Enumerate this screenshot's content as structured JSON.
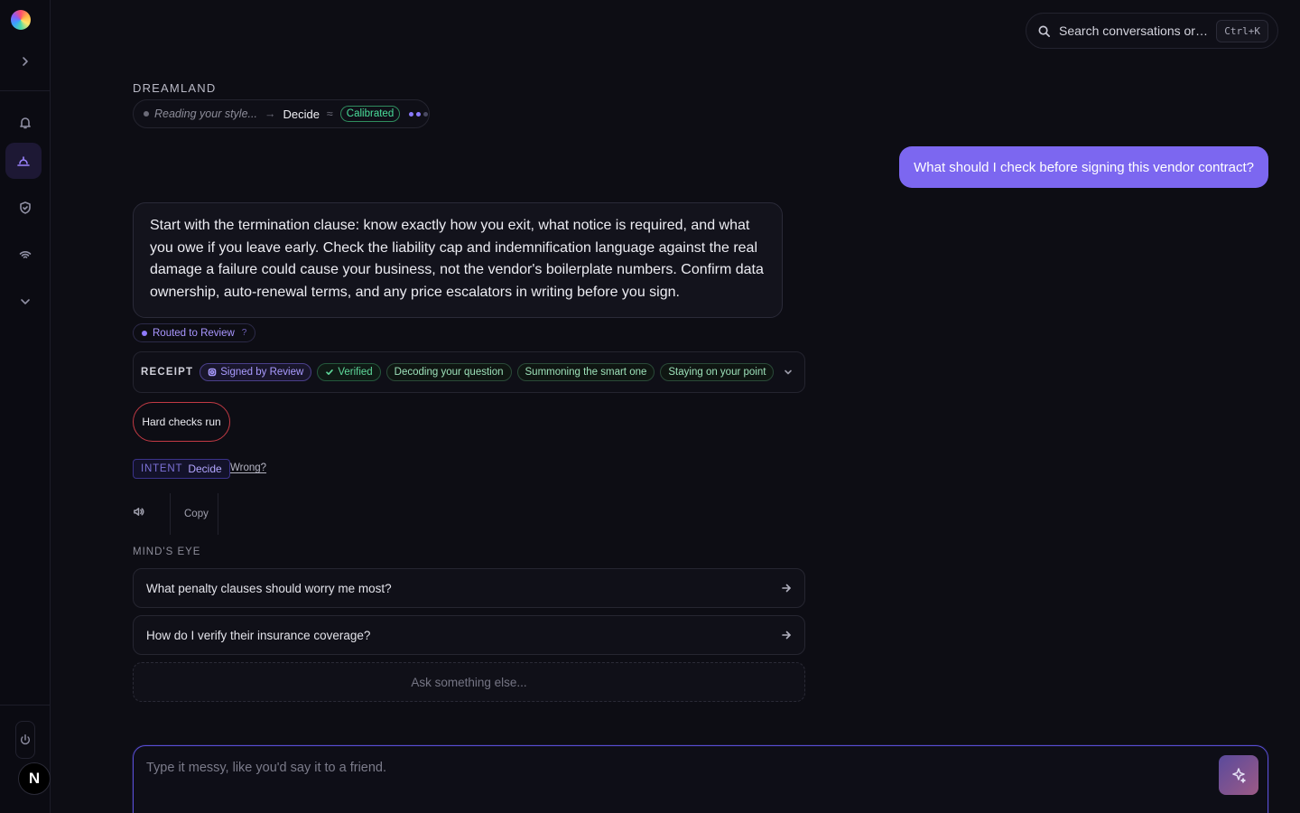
{
  "search": {
    "placeholder": "Search conversations or ju...",
    "shortcut": "Ctrl+K"
  },
  "sidebar": {
    "items": [
      {
        "name": "expand",
        "icon": "chevron-right-icon"
      },
      {
        "name": "notifications",
        "icon": "bell-icon"
      },
      {
        "name": "dreamland",
        "icon": "sunrise-icon",
        "active": true
      },
      {
        "name": "security",
        "icon": "shield-check-icon"
      },
      {
        "name": "signal",
        "icon": "wifi-icon"
      },
      {
        "name": "more",
        "icon": "chevron-down-icon"
      }
    ],
    "power_icon": "power-icon",
    "avatar_initial": "N"
  },
  "header": {
    "brand": "DREAMLAND",
    "status": {
      "reading": "Reading your style...",
      "arrow": "→",
      "mode": "Decide",
      "approx": "≈",
      "badge": "Calibrated"
    }
  },
  "conversation": {
    "user_message": "What should I check before signing this vendor contract?",
    "assistant_message": "Start with the termination clause: know exactly how you exit, what notice is required, and what you owe if you leave early. Check the liability cap and indemnification language against the real damage a failure could cause your business, not the vendor's boilerplate numbers. Confirm data ownership, auto-renewal terms, and any price escalators in writing before you sign.",
    "routed": {
      "label": "Routed to Review",
      "help": "?"
    },
    "receipt": {
      "label": "RECEIPT",
      "chips": [
        {
          "label": "Signed by Review",
          "style": "purple",
          "icon": "seal-icon"
        },
        {
          "label": "Verified",
          "style": "green",
          "icon": "check-icon"
        },
        {
          "label": "Decoding your question",
          "style": "plain"
        },
        {
          "label": "Summoning the smart one",
          "style": "plain"
        },
        {
          "label": "Staying on your point",
          "style": "plain"
        }
      ]
    },
    "hard_checks": "Hard checks run",
    "intent": {
      "label": "INTENT",
      "value": "Decide",
      "wrong": "Wrong?"
    },
    "actions": {
      "copy": "Copy"
    }
  },
  "minds_eye": {
    "title": "MIND'S EYE",
    "suggestions": [
      "What penalty clauses should worry me most?",
      "How do I verify their insurance coverage?"
    ],
    "ask_else": "Ask something else..."
  },
  "composer": {
    "placeholder": "Type it messy, like you'd say it to a friend."
  },
  "colors": {
    "accent": "#7c67f0",
    "success": "#4ade9b",
    "danger": "#c23a44",
    "background": "#0d0d14"
  }
}
